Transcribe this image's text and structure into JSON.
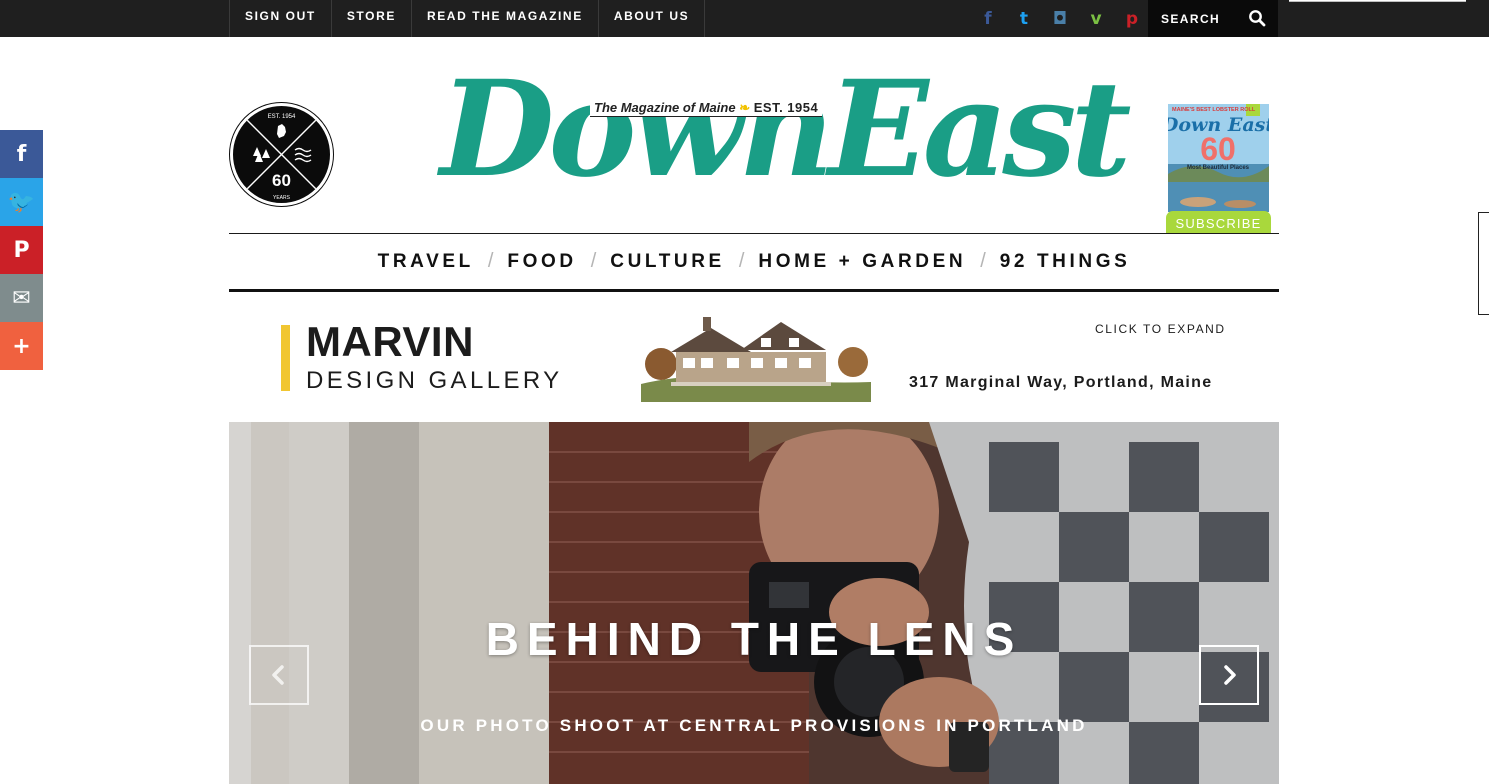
{
  "topnav": {
    "links": [
      "SIGN OUT",
      "STORE",
      "READ THE MAGAZINE",
      "ABOUT US"
    ],
    "social": [
      {
        "icon": "facebook-icon",
        "glyph": "f",
        "color": "#3b5998"
      },
      {
        "icon": "twitter-icon",
        "glyph": "t",
        "color": "#1da1f2"
      },
      {
        "icon": "instagram-icon",
        "glyph": "◘",
        "color": "#4a7fa8"
      },
      {
        "icon": "vine-icon",
        "glyph": "v",
        "color": "#7bc043"
      },
      {
        "icon": "pinterest-icon",
        "glyph": "p",
        "color": "#cb2027"
      }
    ],
    "search_label": "SEARCH"
  },
  "share_rail": [
    {
      "icon": "facebook-icon",
      "glyph": "f",
      "color": "#3b5998"
    },
    {
      "icon": "twitter-icon",
      "glyph": "🐦",
      "color": "#2aa4e8"
    },
    {
      "icon": "pinterest-icon",
      "glyph": "P",
      "color": "#cb2027"
    },
    {
      "icon": "email-icon",
      "glyph": "✉",
      "color": "#7f8c8d"
    },
    {
      "icon": "more-icon",
      "glyph": "+",
      "color": "#f0613f"
    }
  ],
  "header": {
    "badge": {
      "est": "EST. 1954",
      "number": "60",
      "years": "YEARS"
    },
    "logo": {
      "wordmark": "DownEast",
      "tagline": "The Magazine of Maine",
      "est": "EST. 1954"
    },
    "cover": {
      "banner": "MAINE'S BEST LOBSTER ROLL",
      "title": "Down East",
      "number": "60",
      "caption": "Most Beautiful Places"
    },
    "subscribe_label": "SUBSCRIBE"
  },
  "main_nav": [
    "TRAVEL",
    "FOOD",
    "CULTURE",
    "HOME + GARDEN",
    "92 THINGS"
  ],
  "main_nav_separator": "/",
  "ad": {
    "brand": "MARVIN",
    "subbrand": "DESIGN GALLERY",
    "expand": "CLICK TO EXPAND",
    "address": "317 Marginal Way, Portland, Maine"
  },
  "hero": {
    "title": "BEHIND THE LENS",
    "subtitle": "OUR PHOTO SHOOT AT CENTRAL PROVISIONS IN PORTLAND"
  },
  "colors": {
    "brand_teal": "#1a9e86",
    "subscribe_green": "#a9d83c",
    "topbar": "#1f1f1f",
    "ad_accent": "#f1c631"
  }
}
